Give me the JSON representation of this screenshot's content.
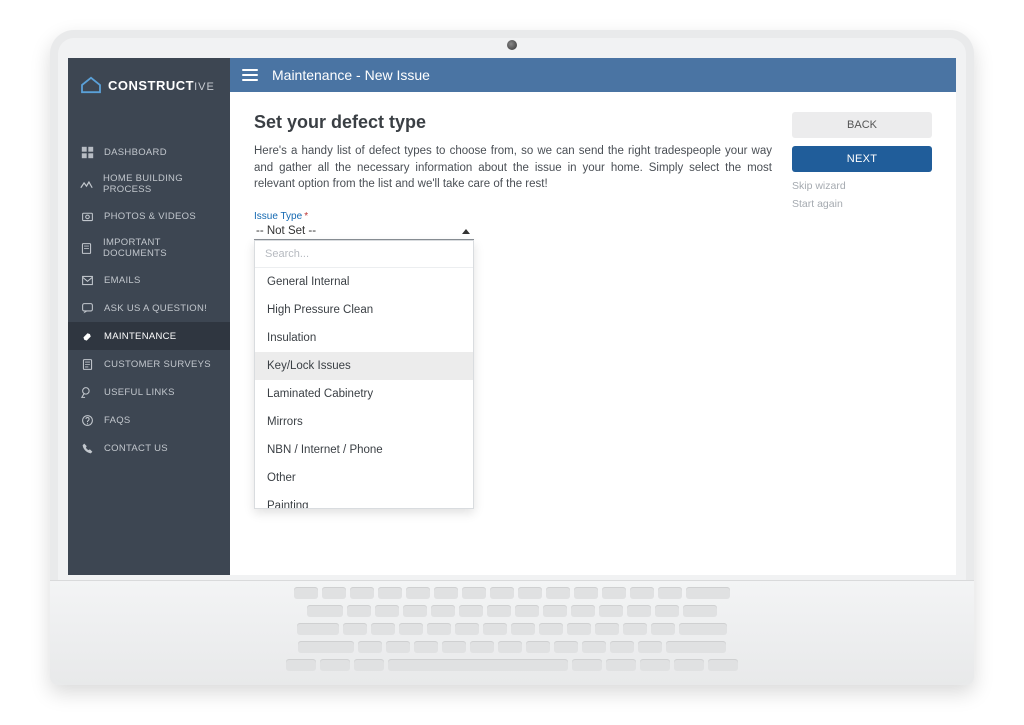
{
  "brand": {
    "main": "CONSTRUCT",
    "suffix": "IVE"
  },
  "sidebar": {
    "items": [
      {
        "label": "DASHBOARD"
      },
      {
        "label": "HOME BUILDING PROCESS"
      },
      {
        "label": "PHOTOS & VIDEOS"
      },
      {
        "label": "IMPORTANT DOCUMENTS"
      },
      {
        "label": "EMAILS"
      },
      {
        "label": "ASK US A QUESTION!"
      },
      {
        "label": "MAINTENANCE"
      },
      {
        "label": "CUSTOMER SURVEYS"
      },
      {
        "label": "USEFUL LINKS"
      },
      {
        "label": "FAQS"
      },
      {
        "label": "CONTACT US"
      }
    ],
    "activeIndex": 6
  },
  "topbar": {
    "title": "Maintenance - New Issue"
  },
  "page": {
    "heading": "Set your defect type",
    "body": "Here's a handy list of defect types to choose from, so we can send the right tradespeople your way and gather all the necessary information about the issue in your home. Simply select the most relevant option from the list and we'll take care of the rest!"
  },
  "field": {
    "label": "Issue Type",
    "required_mark": "*",
    "value": "-- Not Set --"
  },
  "dropdown": {
    "search_placeholder": "Search...",
    "options": [
      "General Internal",
      "High Pressure Clean",
      "Insulation",
      "Key/Lock Issues",
      "Laminated Cabinetry",
      "Mirrors",
      "NBN / Internet / Phone",
      "Other",
      "Painting"
    ],
    "highlightIndex": 3
  },
  "actions": {
    "back": "BACK",
    "next": "NEXT",
    "skip": "Skip wizard",
    "start_again": "Start again"
  }
}
